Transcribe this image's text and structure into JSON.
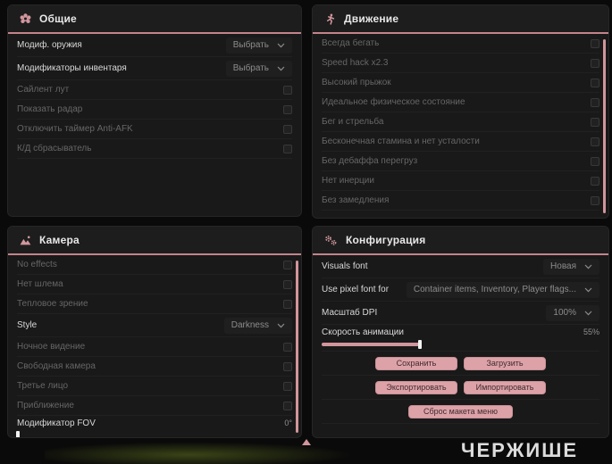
{
  "theme": {
    "page_bg": "#0a0a0a",
    "panel_bg": "#191919",
    "accent_pink": "#c2848b",
    "button_pink": "#dda2a8",
    "scrollbar_pink": "#d2959b"
  },
  "panels": [
    {
      "title": "Общие",
      "icon": "flower-icon",
      "rows": [
        {
          "type": "dropdown",
          "label": "Модиф. оружия",
          "value": "Выбрать",
          "bright": true
        },
        {
          "type": "dropdown",
          "label": "Модификаторы инвентаря",
          "value": "Выбрать",
          "bright": true
        },
        {
          "type": "checkbox",
          "label": "Сайлент лут",
          "checked": false
        },
        {
          "type": "checkbox",
          "label": "Показать радар",
          "checked": false
        },
        {
          "type": "checkbox",
          "label": "Отключить таймер Anti-AFK",
          "checked": false
        },
        {
          "type": "checkbox",
          "label": "К/Д сбрасыватель",
          "checked": false
        }
      ]
    },
    {
      "title": "Движение",
      "icon": "runner-icon",
      "scrollbar": true,
      "rows": [
        {
          "type": "checkbox",
          "label": "Всегда бегать",
          "checked": false
        },
        {
          "type": "checkbox",
          "label": "Speed hack x2.3",
          "checked": false
        },
        {
          "type": "checkbox",
          "label": "Высокий прыжок",
          "checked": false
        },
        {
          "type": "checkbox",
          "label": "Идеальное физическое состояние",
          "checked": false
        },
        {
          "type": "checkbox",
          "label": "Бег и стрельба",
          "checked": false
        },
        {
          "type": "checkbox",
          "label": "Бесконечная стамина и нет усталости",
          "checked": false
        },
        {
          "type": "checkbox",
          "label": "Без дебаффа перегруз",
          "checked": false
        },
        {
          "type": "checkbox",
          "label": "Нет инерции",
          "checked": false
        },
        {
          "type": "checkbox",
          "label": "Без замедления",
          "checked": false
        }
      ]
    },
    {
      "title": "Камера",
      "icon": "picture-icon",
      "scrollbar": true,
      "rows": [
        {
          "type": "checkbox",
          "label": "No effects",
          "checked": false
        },
        {
          "type": "checkbox",
          "label": "Нет шлема",
          "checked": false
        },
        {
          "type": "checkbox",
          "label": "Тепловое зрение",
          "checked": false
        },
        {
          "type": "dropdown",
          "label": "Style",
          "value": "Darkness",
          "bright": true
        },
        {
          "type": "checkbox",
          "label": "Ночное видение",
          "checked": false
        },
        {
          "type": "checkbox",
          "label": "Свободная камера",
          "checked": false
        },
        {
          "type": "checkbox",
          "label": "Третье лицо",
          "checked": false
        },
        {
          "type": "checkbox",
          "label": "Приближение",
          "checked": false
        },
        {
          "type": "slider",
          "label": "Модификатор FOV",
          "value": "0°",
          "fill": 0,
          "track": false,
          "bright": true
        }
      ]
    },
    {
      "title": "Конфигурация",
      "icon": "gears-icon",
      "rows": [
        {
          "type": "dropdown",
          "label": "Visuals font",
          "value": "Новая",
          "bright": true
        },
        {
          "type": "dropdown",
          "label": "Use pixel font for",
          "value": "Container items, Inventory, Player flags...",
          "bright": true,
          "wide": true
        },
        {
          "type": "dropdown",
          "label": "Масштаб DPI",
          "value": "100%",
          "bright": true
        },
        {
          "type": "slider",
          "label": "Скорость анимации",
          "value": "55%",
          "fill": 55,
          "track": true,
          "bright": true
        },
        {
          "type": "buttons",
          "buttons": [
            {
              "label": "Сохранить",
              "name": "save-button"
            },
            {
              "label": "Загрузить",
              "name": "load-button"
            }
          ]
        },
        {
          "type": "buttons",
          "buttons": [
            {
              "label": "Экспортировать",
              "name": "export-button"
            },
            {
              "label": "Импортировать",
              "name": "import-button"
            }
          ]
        },
        {
          "type": "buttons",
          "center": true,
          "buttons": [
            {
              "label": "Сброс макета меню",
              "name": "reset-menu-layout-button"
            }
          ]
        }
      ]
    }
  ],
  "footer": {
    "watermark": "ЧЕРЖИШЕ",
    "cursor_icon": "pink-triangle-cursor"
  }
}
